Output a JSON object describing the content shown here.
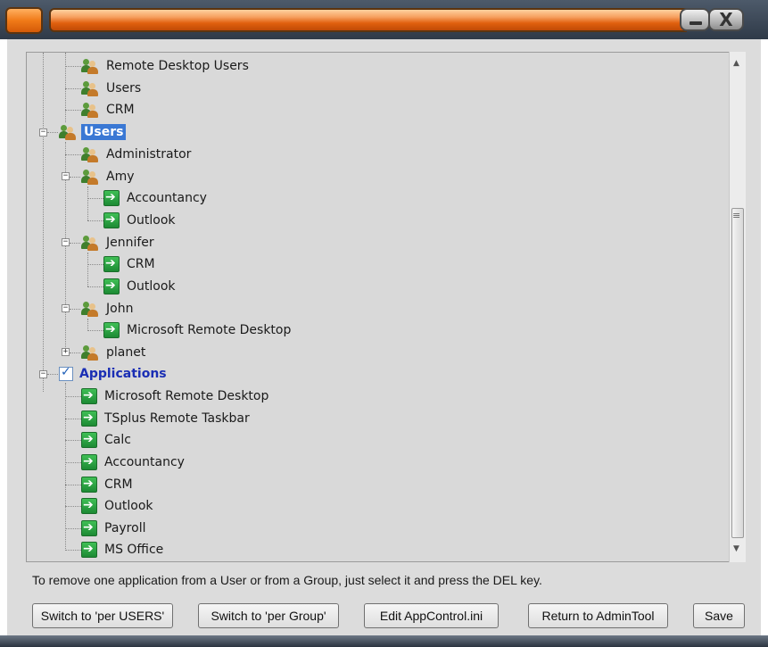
{
  "tree": {
    "rows": [
      {
        "label": "Remote Desktop Users",
        "icon": "users-icon"
      },
      {
        "label": "Users",
        "icon": "users-icon"
      },
      {
        "label": "CRM",
        "icon": "users-icon"
      },
      {
        "label": "Users",
        "icon": "users-icon",
        "selected": true
      },
      {
        "label": "Administrator",
        "icon": "users-icon"
      },
      {
        "label": "Amy",
        "icon": "users-icon"
      },
      {
        "label": "Accountancy",
        "icon": "app-arrow-icon"
      },
      {
        "label": "Outlook",
        "icon": "app-arrow-icon"
      },
      {
        "label": "Jennifer",
        "icon": "users-icon"
      },
      {
        "label": "CRM",
        "icon": "app-arrow-icon"
      },
      {
        "label": "Outlook",
        "icon": "app-arrow-icon"
      },
      {
        "label": "John",
        "icon": "users-icon"
      },
      {
        "label": "Microsoft Remote Desktop",
        "icon": "app-arrow-icon"
      },
      {
        "label": "planet",
        "icon": "users-icon",
        "collapsed": true
      },
      {
        "label": "Applications",
        "icon": "checklist-icon"
      },
      {
        "label": "Microsoft Remote Desktop",
        "icon": "app-arrow-icon"
      },
      {
        "label": "TSplus Remote Taskbar",
        "icon": "app-arrow-icon"
      },
      {
        "label": "Calc",
        "icon": "app-arrow-icon"
      },
      {
        "label": "Accountancy",
        "icon": "app-arrow-icon"
      },
      {
        "label": "CRM",
        "icon": "app-arrow-icon"
      },
      {
        "label": "Outlook",
        "icon": "app-arrow-icon"
      },
      {
        "label": "Payroll",
        "icon": "app-arrow-icon"
      },
      {
        "label": "MS Office",
        "icon": "app-arrow-icon"
      }
    ]
  },
  "hint": "To remove one application from a User or from a Group, just select it and press the DEL key.",
  "buttons": {
    "per_users": "Switch to 'per USERS'",
    "per_group": "Switch to 'per Group'",
    "edit_ini": "Edit AppControl.ini",
    "return_admin": "Return to AdminTool",
    "save": "Save"
  },
  "titlebar": {
    "close_glyph": "X"
  },
  "colors": {
    "titlebar_orange": "#f07a18",
    "selection": "#3a78d4",
    "group_text": "#1a2eb4",
    "app_icon_green": "#1d8a34"
  }
}
